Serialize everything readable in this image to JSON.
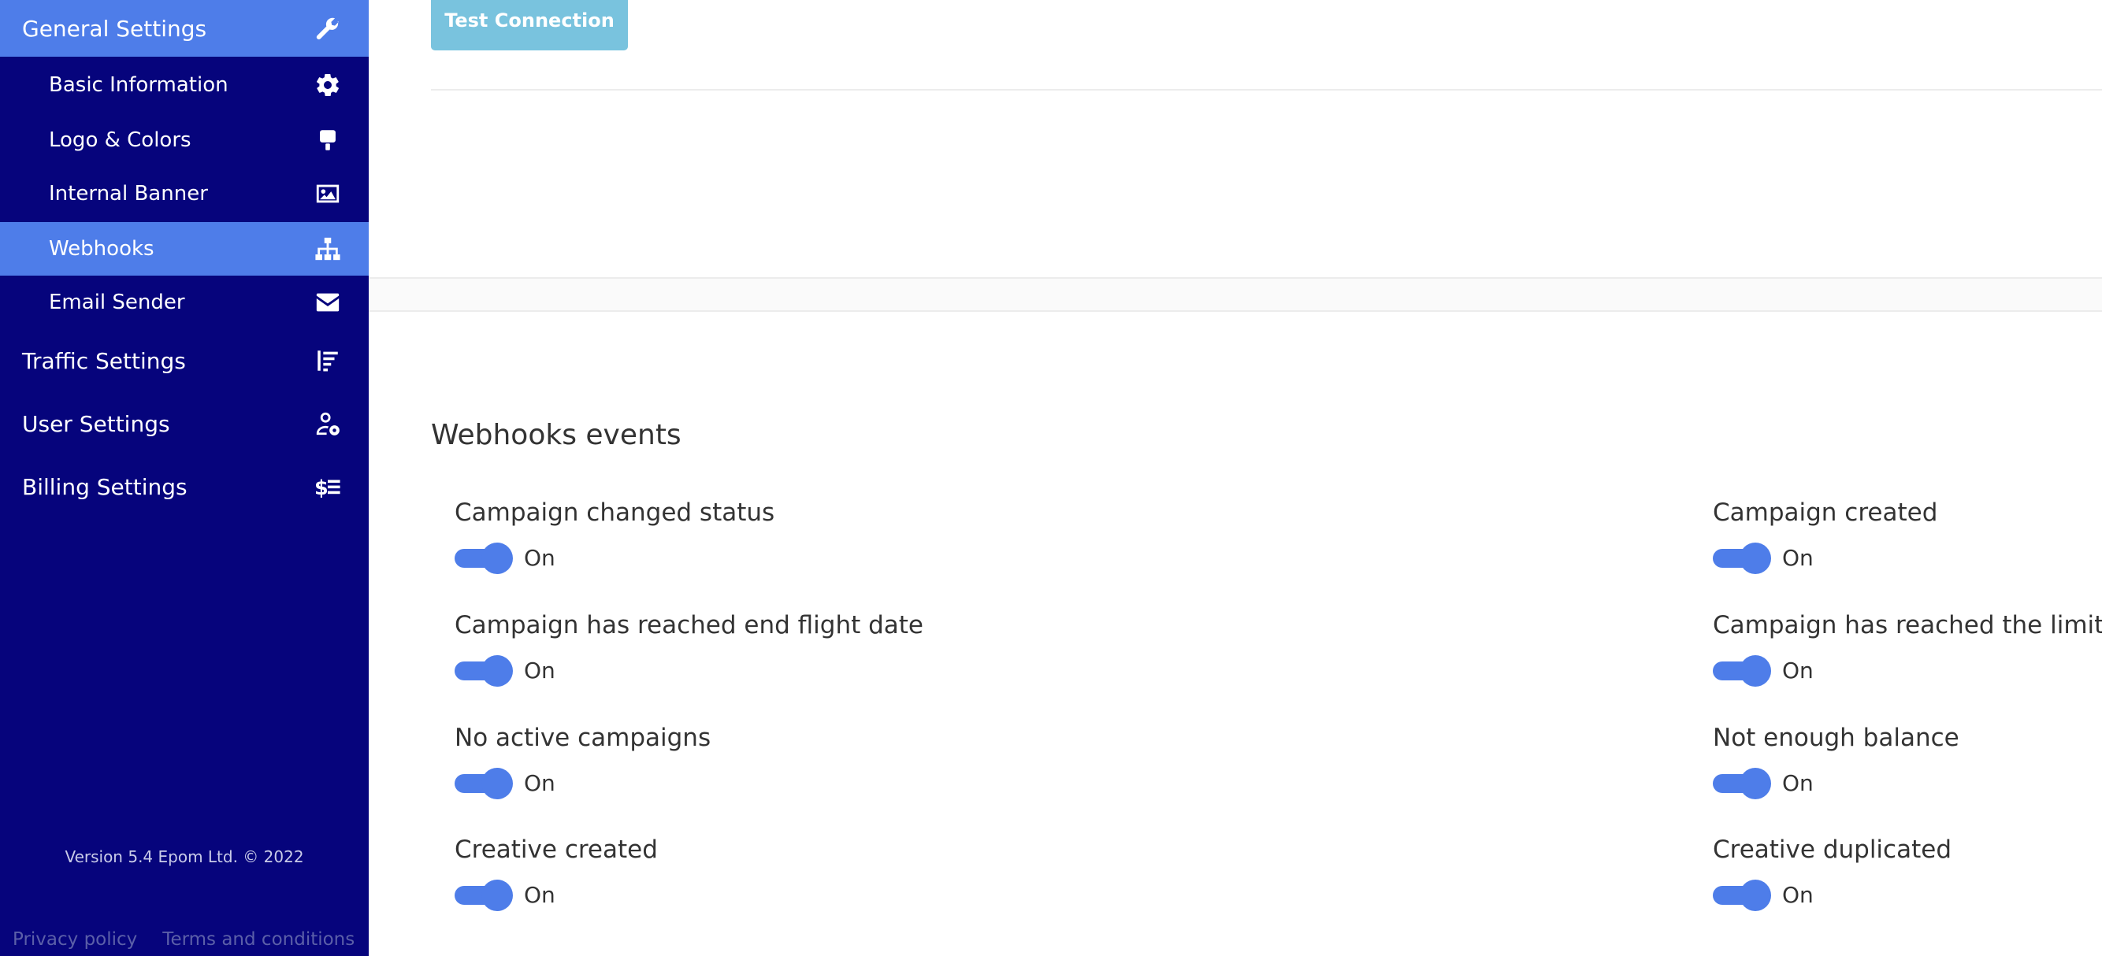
{
  "sidebar": {
    "top_items": [
      {
        "label": "General Settings",
        "icon": "wrench-icon"
      },
      {
        "label": "Traffic Settings",
        "icon": "sort-lines-icon"
      },
      {
        "label": "User Settings",
        "icon": "users-cog-icon"
      },
      {
        "label": "Billing Settings",
        "icon": "dollar-list-icon"
      }
    ],
    "sub_items": [
      {
        "label": "Basic Information",
        "icon": "gear-icon"
      },
      {
        "label": "Logo & Colors",
        "icon": "paint-brush-icon"
      },
      {
        "label": "Internal Banner",
        "icon": "image-icon"
      },
      {
        "label": "Webhooks",
        "icon": "sitemap-icon"
      },
      {
        "label": "Email Sender",
        "icon": "envelope-icon"
      }
    ],
    "active_top": "General Settings",
    "active_sub": "Webhooks",
    "version": "Version 5.4 Epom Ltd. © 2022",
    "footer_links": [
      "Privacy policy",
      "Terms and conditions"
    ]
  },
  "main": {
    "test_connection_label": "Test Connection",
    "section_title": "Webhooks events",
    "events_left": [
      {
        "label": "Campaign changed status",
        "state": "On"
      },
      {
        "label": "Campaign has reached end flight date",
        "state": "On"
      },
      {
        "label": "No active campaigns",
        "state": "On"
      },
      {
        "label": "Creative created",
        "state": "On"
      }
    ],
    "events_right": [
      {
        "label": "Campaign created",
        "state": "On"
      },
      {
        "label": "Campaign has reached the limit",
        "state": "On"
      },
      {
        "label": "Not enough balance",
        "state": "On"
      },
      {
        "label": "Creative duplicated",
        "state": "On"
      }
    ]
  },
  "colors": {
    "sidebar_bg": "#06047c",
    "accent": "#4e7de9",
    "button_bg": "#79c3de"
  }
}
